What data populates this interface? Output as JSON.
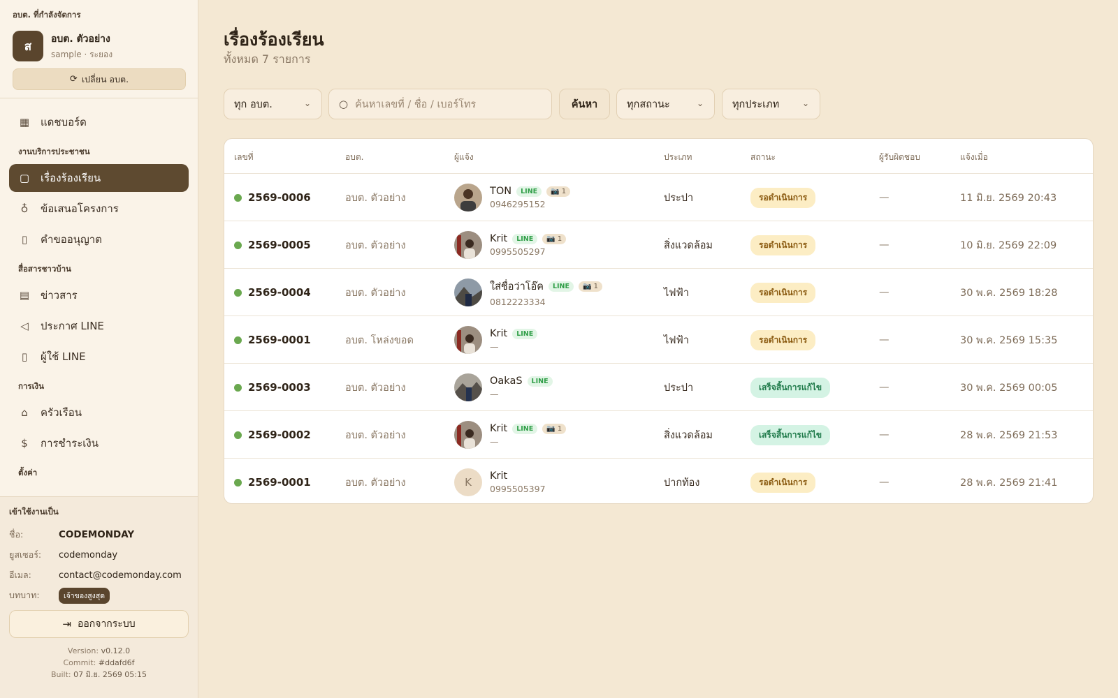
{
  "org": {
    "caption": "อบต. ที่กำลังจัดการ",
    "avatar_letter": "ส",
    "name": "อบต. ตัวอย่าง",
    "sub": "sample · ระยอง",
    "switch_label": "เปลี่ยน อบต."
  },
  "nav": {
    "dashboard": "แดชบอร์ด",
    "section_public": "งานบริการประชาชน",
    "complaints": "เรื่องร้องเรียน",
    "proposals": "ข้อเสนอโครงการ",
    "permits": "คำขออนุญาต",
    "section_media": "สื่อสารชาวบ้าน",
    "news": "ข่าวสาร",
    "line_announce": "ประกาศ LINE",
    "line_users": "ผู้ใช้ LINE",
    "section_finance": "การเงิน",
    "households": "ครัวเรือน",
    "payments": "การชำระเงิน",
    "section_settings": "ตั้งค่า"
  },
  "user": {
    "caption": "เข้าใช้งานเป็น",
    "name_label": "ชื่อ:",
    "name": "CODEMONDAY",
    "username_label": "ยูสเซอร์:",
    "username": "codemonday",
    "email_label": "อีเมล:",
    "email": "contact@codemonday.com",
    "role_label": "บทบาท:",
    "role": "เจ้าของสูงสุด",
    "logout_label": "ออกจากระบบ",
    "version_label": "Version:",
    "version": "v0.12.0",
    "commit_label": "Commit:",
    "commit": "#ddafd6f",
    "built_label": "Built:",
    "built": "07 มิ.ย. 2569 05:15"
  },
  "page": {
    "title": "เรื่องร้องเรียน",
    "subtitle": "ทั้งหมด 7 รายการ"
  },
  "filters": {
    "org": "ทุก อบต.",
    "search_placeholder": "ค้นหาเลขที่ / ชื่อ / เบอร์โทร",
    "search_button": "ค้นหา",
    "status": "ทุกสถานะ",
    "type": "ทุกประเภท"
  },
  "table": {
    "headers": {
      "id": "เลขที่",
      "org": "อบต.",
      "reporter": "ผู้แจ้ง",
      "type": "ประเภท",
      "status": "สถานะ",
      "assignee": "ผู้รับผิดชอบ",
      "reported_at": "แจ้งเมื่อ"
    },
    "rows": [
      {
        "id": "2569-0006",
        "org": "อบต. ตัวอย่าง",
        "name": "TON",
        "line": "LINE",
        "cam": "📷 1",
        "phone": "0946295152",
        "type": "ประปา",
        "status": "รอดำเนินการ",
        "assignee": "—",
        "date": "11 มิ.ย. 2569 20:43"
      },
      {
        "id": "2569-0005",
        "org": "อบต. ตัวอย่าง",
        "name": "Krit",
        "line": "LINE",
        "cam": "📷 1",
        "phone": "0995505297",
        "type": "สิ่งแวดล้อม",
        "status": "รอดำเนินการ",
        "assignee": "—",
        "date": "10 มิ.ย. 2569 22:09"
      },
      {
        "id": "2569-0004",
        "org": "อบต. ตัวอย่าง",
        "name": "ใส่ชื่อว่าโอ๊ค",
        "line": "LINE",
        "cam": "📷 1",
        "phone": "0812223334",
        "type": "ไฟฟ้า",
        "status": "รอดำเนินการ",
        "assignee": "—",
        "date": "30 พ.ค. 2569 18:28"
      },
      {
        "id": "2569-0001",
        "org": "อบต. โหล่งขอด",
        "name": "Krit",
        "line": "LINE",
        "cam": "",
        "phone": "—",
        "type": "ไฟฟ้า",
        "status": "รอดำเนินการ",
        "assignee": "—",
        "date": "30 พ.ค. 2569 15:35"
      },
      {
        "id": "2569-0003",
        "org": "อบต. ตัวอย่าง",
        "name": "OakaS",
        "line": "LINE",
        "cam": "",
        "phone": "—",
        "type": "ประปา",
        "status": "เสร็จสิ้นการแก้ไข",
        "assignee": "—",
        "date": "30 พ.ค. 2569 00:05"
      },
      {
        "id": "2569-0002",
        "org": "อบต. ตัวอย่าง",
        "name": "Krit",
        "line": "LINE",
        "cam": "📷 1",
        "phone": "—",
        "type": "สิ่งแวดล้อม",
        "status": "เสร็จสิ้นการแก้ไข",
        "assignee": "—",
        "date": "28 พ.ค. 2569 21:53"
      },
      {
        "id": "2569-0001",
        "org": "อบต. ตัวอย่าง",
        "name": "Krit",
        "line": "",
        "cam": "",
        "avatar_letter": "K",
        "phone": "0995505397",
        "type": "ปากท้อง",
        "status": "รอดำเนินการ",
        "assignee": "—",
        "date": "28 พ.ค. 2569 21:41"
      }
    ]
  },
  "colors": {
    "accent": "#5e4a30",
    "background": "#f4e8d3",
    "status_pending_bg": "#fcedc4",
    "status_done_bg": "#d4f3e4",
    "line_green": "#2f9e47"
  }
}
